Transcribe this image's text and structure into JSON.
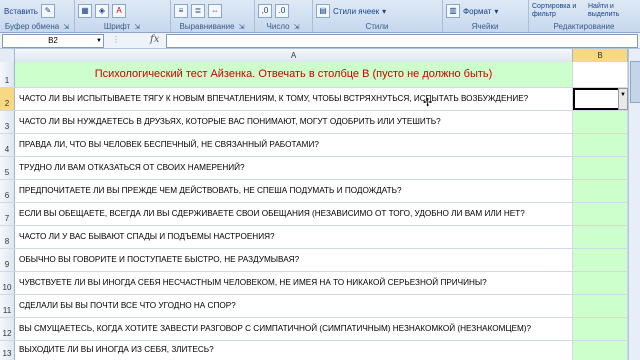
{
  "ribbon": {
    "paste_label": "Вставить",
    "groups": [
      {
        "name": "Буфер обмена"
      },
      {
        "name": "Шрифт"
      },
      {
        "name": "Выравнивание"
      },
      {
        "name": "Число"
      },
      {
        "name": "Стили"
      },
      {
        "name": "Ячейки"
      },
      {
        "name": "Редактирование"
      }
    ],
    "styles_button": "Стили ячеек",
    "format_button": "Формат",
    "sort_filter": "Сортировка и фильтр",
    "find_select": "Найти и выделить"
  },
  "formula_bar": {
    "cell_name": "B2",
    "fx": "fx",
    "value": ""
  },
  "columns": [
    "A",
    "B"
  ],
  "rows": [
    {
      "num": "1",
      "a": "Психологический тест Айзенка.   Отвечать в столбце В   (пусто не должно быть)",
      "title": true
    },
    {
      "num": "2",
      "a": "ЧАСТО ЛИ ВЫ ИСПЫТЫВАЕТЕ ТЯГУ К НОВЫМ ВПЕЧАТЛЕНИЯМ, К ТОМУ, ЧТОБЫ ВСТРЯХНУТЬСЯ, ИСПЫТАТЬ ВОЗБУЖДЕНИЕ?",
      "active": true
    },
    {
      "num": "3",
      "a": "ЧАСТО ЛИ ВЫ НУЖДАЕТЕСЬ В ДРУЗЬЯХ, КОТОРЫЕ ВАС ПОНИМАЮТ,  МОГУТ ОДОБРИТЬ ИЛИ УТЕШИТЬ?"
    },
    {
      "num": "4",
      "a": "ПРАВДА ЛИ, ЧТО ВЫ ЧЕЛОВЕК БЕСПЕЧНЫЙ, НЕ СВЯЗАННЫЙ РАБОТАМИ?"
    },
    {
      "num": "5",
      "a": "ТРУДНО ЛИ ВАМ  ОТКАЗАТЬСЯ ОТ СВОИХ НАМЕРЕНИЙ?"
    },
    {
      "num": "6",
      "a": "ПРЕДПОЧИТАЕТЕ ЛИ ВЫ ПРЕЖДЕ ЧЕМ ДЕЙСТВОВАТЬ, НЕ СПЕША ПОДУМАТЬ И ПОДОЖДАТЬ?"
    },
    {
      "num": "7",
      "a": "ЕСЛИ ВЫ ОБЕЩАЕТЕ, ВСЕГДА ЛИ ВЫ СДЕРЖИВАЕТЕ СВОИ ОБЕЩАНИЯ (НЕЗАВИСИМО ОТ ТОГО, УДОБНО ЛИ ВАМ ИЛИ НЕТ?"
    },
    {
      "num": "8",
      "a": "ЧАСТО ЛИ У ВАС БЫВАЮТ СПАДЫ И ПОДЪЕМЫ НАСТРОЕНИЯ?"
    },
    {
      "num": "9",
      "a": "ОБЫЧНО ВЫ ГОВОРИТЕ И ПОСТУПАЕТЕ БЫСТРО, НЕ РАЗДУМЫВАЯ?"
    },
    {
      "num": "10",
      "a": "ЧУВСТВУЕТЕ ЛИ ВЫ ИНОГДА СЕБЯ НЕСЧАСТНЫМ ЧЕЛОВЕКОМ, НЕ ИМЕЯ НА ТО НИКАКОЙ СЕРЬЕЗНОЙ ПРИЧИНЫ?"
    },
    {
      "num": "11",
      "a": "СДЕЛАЛИ БЫ ВЫ ПОЧТИ ВСЕ ЧТО УГОДНО НА СПОР?"
    },
    {
      "num": "12",
      "a": "ВЫ СМУЩАЕТЕСЬ, КОГДА ХОТИТЕ ЗАВЕСТИ РАЗГОВОР С СИМПАТИЧНОЙ (СИМПАТИЧНЫМ) НЕЗНАКОМКОЙ (НЕЗНАКОМЦЕМ)?"
    },
    {
      "num": "13",
      "a": "ВЫХОДИТЕ ЛИ ВЫ ИНОГДА ИЗ СЕБЯ, ЗЛИТЕСЬ?"
    }
  ]
}
